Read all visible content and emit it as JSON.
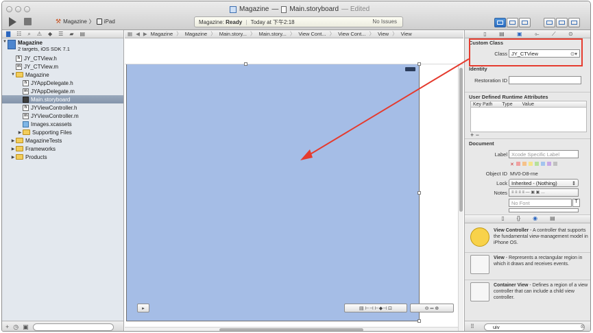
{
  "window": {
    "title_project": "Magazine",
    "title_dash": "—",
    "title_file": "Main.storyboard",
    "title_edited": "— Edited"
  },
  "toolbar": {
    "scheme_name": "Magazine",
    "scheme_sep": "〉",
    "device": "iPad",
    "status_project": "Magazine:",
    "status_state": "Ready",
    "status_time": "Today at 下午2:18",
    "status_issues": "No Issues"
  },
  "navigator": {
    "project_name": "Magazine",
    "project_sub": "2 targets, iOS SDK 7.1",
    "items": [
      {
        "label": "JY_CTView.h",
        "badge": "h"
      },
      {
        "label": "JY_CTView.m",
        "badge": "m"
      },
      {
        "label": "Magazine"
      },
      {
        "label": "JYAppDelegate.h",
        "badge": "h"
      },
      {
        "label": "JYAppDelegate.m",
        "badge": "m"
      },
      {
        "label": "Main.storyboard"
      },
      {
        "label": "JYViewController.h",
        "badge": "h"
      },
      {
        "label": "JYViewController.m",
        "badge": "m"
      },
      {
        "label": "Images.xcassets"
      },
      {
        "label": "Supporting Files"
      },
      {
        "label": "MagazineTests"
      },
      {
        "label": "Frameworks"
      },
      {
        "label": "Products"
      }
    ]
  },
  "jumpbar": {
    "items": [
      "Magazine",
      "Magazine",
      "Main.story...",
      "Main.story...",
      "View Cont...",
      "View Cont...",
      "View",
      "View"
    ]
  },
  "inspector": {
    "custom_class_header": "Custom Class",
    "class_label": "Class",
    "class_value": "JY_CTView",
    "identity_header": "Identity",
    "restoration_label": "Restoration ID",
    "udra_header": "User Defined Runtime Attributes",
    "col_keypath": "Key Path",
    "col_type": "Type",
    "col_value": "Value",
    "add_remove": "+  −",
    "document_header": "Document",
    "label_label": "Label",
    "label_placeholder": "Xcode Specific Label",
    "object_id_label": "Object ID",
    "object_id_value": "MV0-D8-rne",
    "lock_label": "Lock",
    "lock_value": "Inherited - (Nothing)",
    "notes_label": "Notes",
    "font_placeholder": "No Font",
    "library": [
      {
        "name": "View Controller",
        "desc": " - A controller that supports the fundamental view-management model in iPhone OS."
      },
      {
        "name": "View",
        "desc": " - Represents a rectangular region in which it draws and receives events."
      },
      {
        "name": "Container View",
        "desc": " - Defines a region of a view controller that can include a child view controller."
      }
    ],
    "filter_value": "uiv"
  },
  "colors": {
    "scene_bg": "#a5bde6",
    "highlight": "#e53b2e",
    "selection": "#8394ab"
  }
}
